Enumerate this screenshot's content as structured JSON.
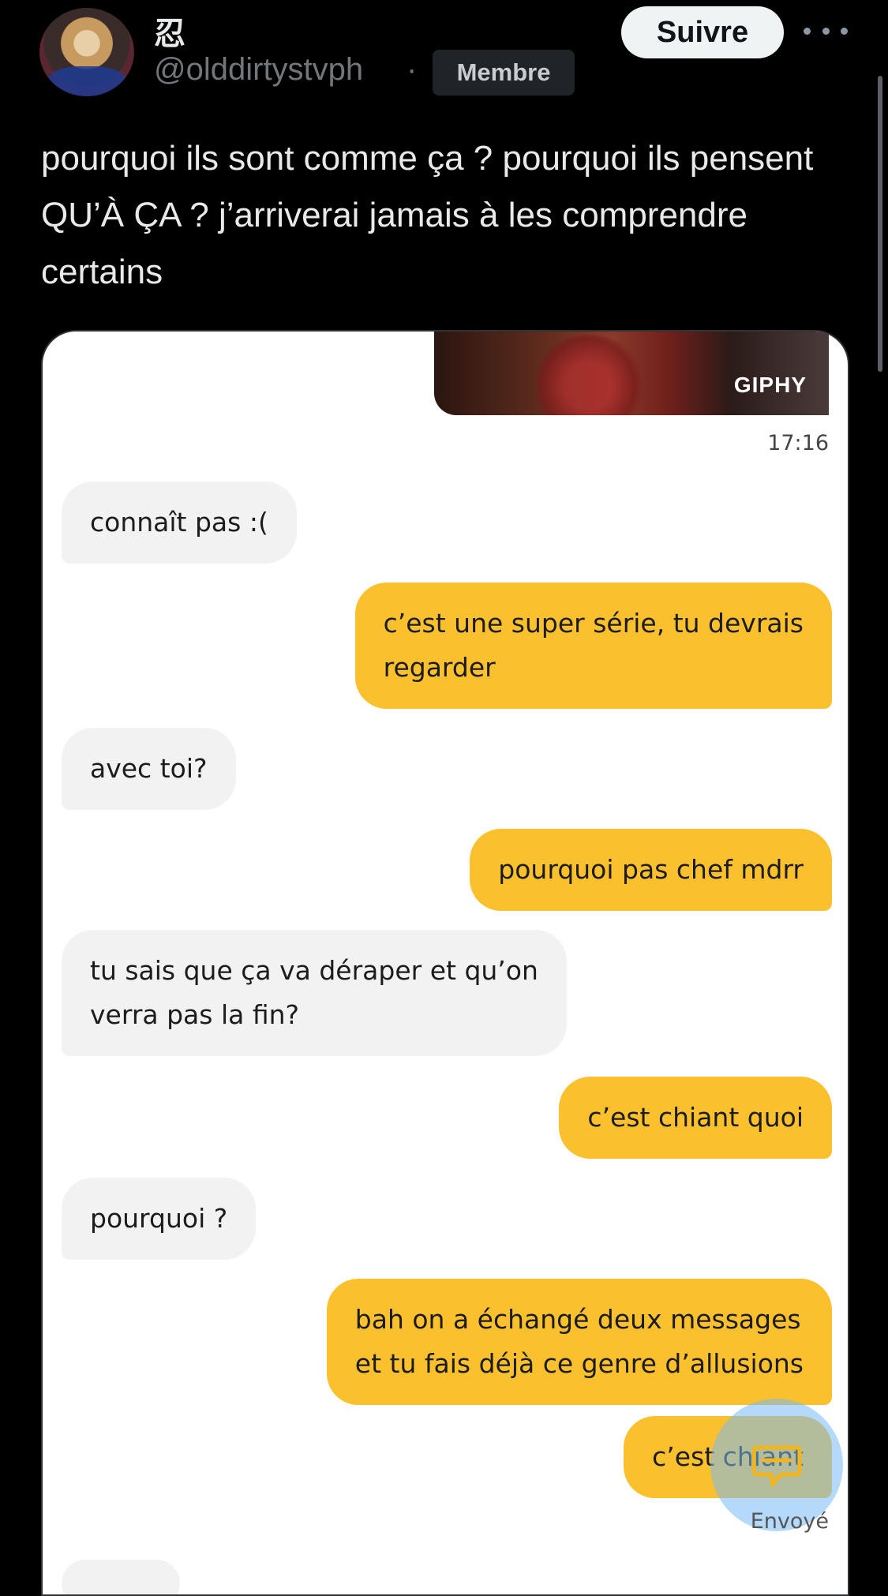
{
  "post": {
    "display_name": "忍",
    "handle": "@olddirtystvph",
    "separator": "·",
    "badge": "Membre",
    "follow_label": "Suivre",
    "text": "pourquoi ils sont comme ça ? pourquoi ils pensent QU’À ÇA ? j’arriverai jamais à les comprendre certains"
  },
  "chat": {
    "gif_label": "GIPHY",
    "timestamp": "17:16",
    "messages": [
      {
        "side": "in",
        "text": "connaît pas :("
      },
      {
        "side": "out",
        "text": "c’est une super série, tu devrais\nregarder"
      },
      {
        "side": "in",
        "text": "avec toi?"
      },
      {
        "side": "out",
        "text": "pourquoi pas chef mdrr"
      },
      {
        "side": "in",
        "text": "tu sais que ça va déraper et qu’on\nverra pas la fin?"
      },
      {
        "side": "out",
        "text": "c’est chiant quoi"
      },
      {
        "side": "in",
        "text": "pourquoi ?"
      },
      {
        "side": "out",
        "text": "bah on a échangé deux messages\net tu fais déjà ce genre d’allusions"
      },
      {
        "side": "out",
        "text": "c’est chiant"
      }
    ],
    "status": "Envoyé"
  },
  "colors": {
    "background": "#000000",
    "outgoing_bubble": "#fbc02d",
    "incoming_bubble": "#f2f2f2",
    "follow_button": "#eff3f4"
  },
  "icons": [
    "more-icon",
    "reply-bubble-icon"
  ]
}
